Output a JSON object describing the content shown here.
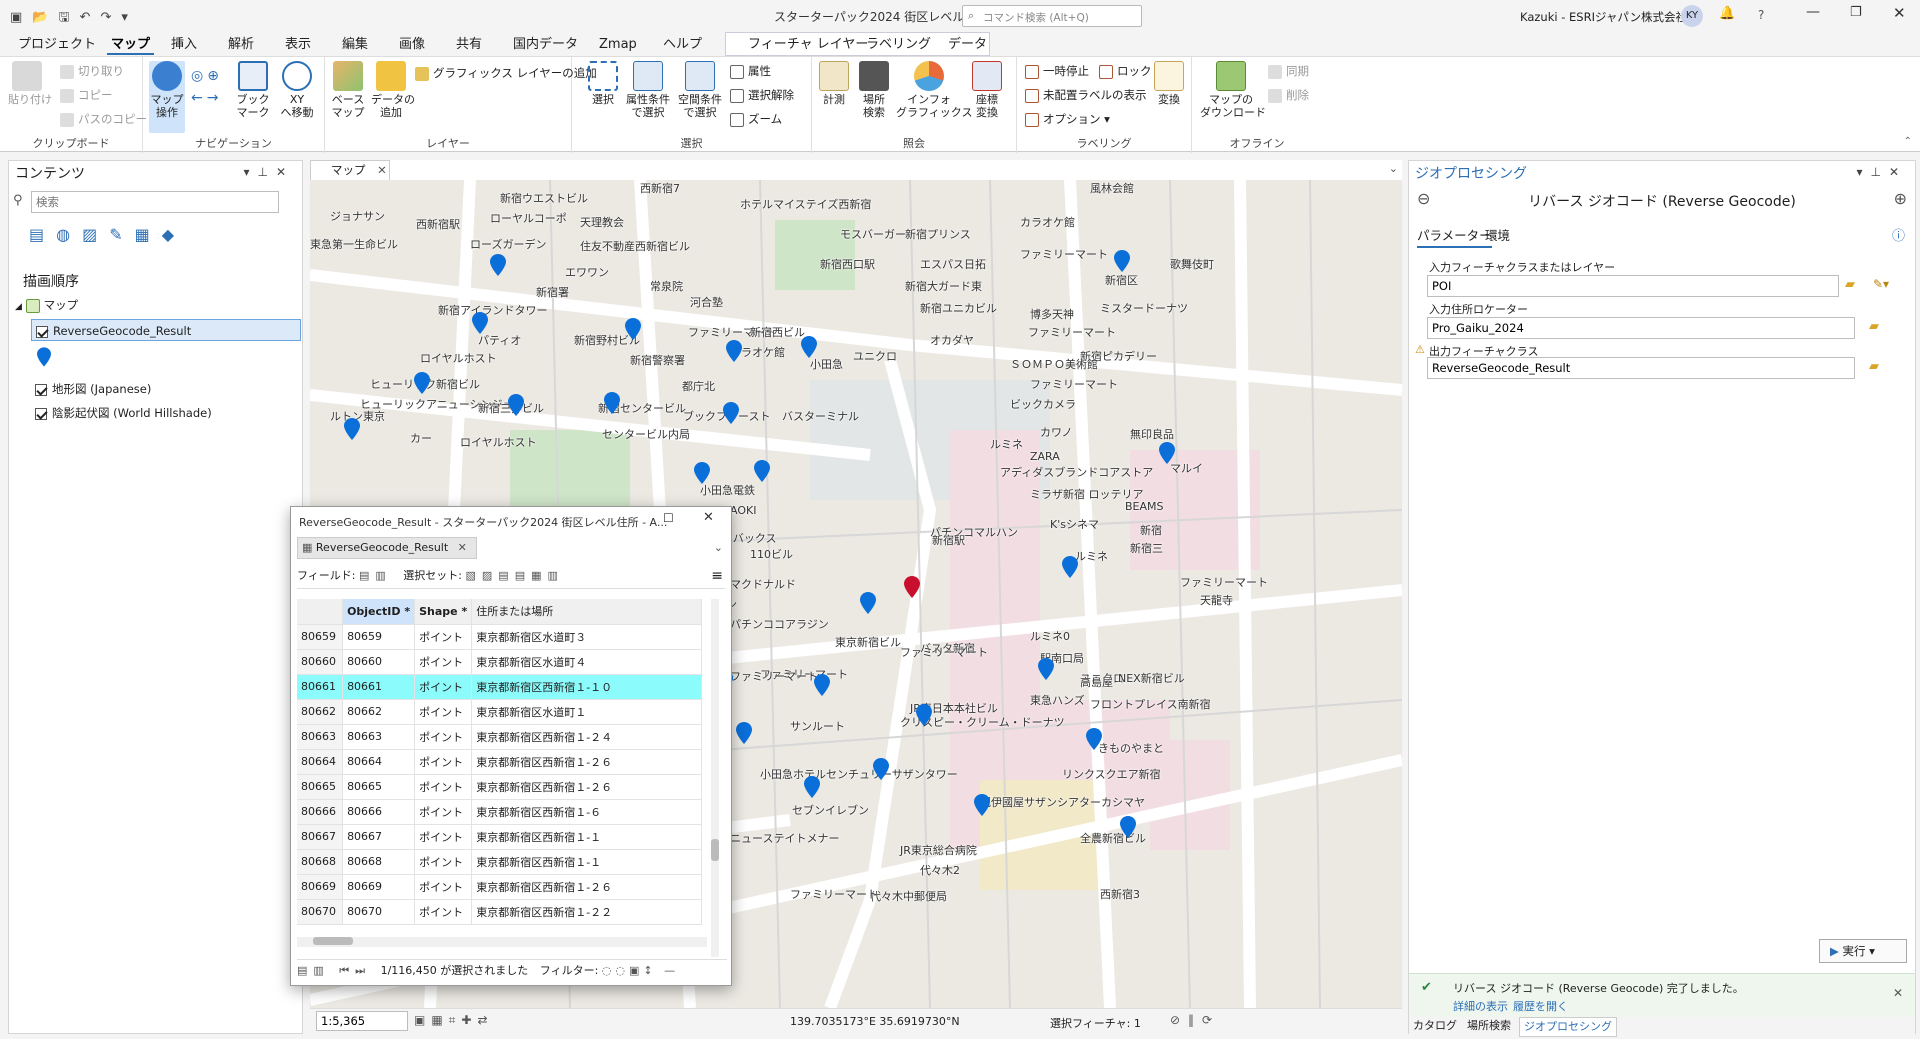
{
  "window": {
    "title": "スターターパック2024 街区レベル住所",
    "search_placeholder": "コマンド検索 (Alt+Q)",
    "user": "Kazuki - ESRIジャパン株式会社",
    "user_initials": "KY"
  },
  "ribbon_tabs": [
    "プロジェクト",
    "マップ",
    "挿入",
    "解析",
    "表示",
    "編集",
    "画像",
    "共有",
    "国内データ",
    "Zmap",
    "ヘルプ",
    "フィーチャ レイヤー",
    "ラベリング",
    "データ"
  ],
  "ribbon": {
    "clipboard": {
      "paste": "貼り付け",
      "cut": "切り取り",
      "copy": "コピー",
      "copy_path": "パスのコピー",
      "group": "クリップボード"
    },
    "navigation": {
      "explore": "マップ\n操作",
      "bookmark": "ブック\nマーク",
      "xy": "XY\nへ移動",
      "group": "ナビゲーション"
    },
    "layer": {
      "basemap": "ベース\nマップ",
      "add_data": "データの\n追加",
      "add_graphics": "グラフィックス レイヤーの追加",
      "group": "レイヤー"
    },
    "selection": {
      "select": "選択",
      "by_attr": "属性条件\nで選択",
      "by_loc": "空間条件\nで選択",
      "attributes": "属性",
      "clear": "選択解除",
      "zoom": "ズーム",
      "group": "選択"
    },
    "inquiry": {
      "measure": "計測",
      "locate": "場所\n検索",
      "infographics": "インフォ\nグラフィックス",
      "coord": "座標\n変換",
      "group": "照会"
    },
    "labeling": {
      "pause": "一時停止",
      "lock": "ロック",
      "unplaced": "未配置ラベルの表示",
      "convert": "変換",
      "options": "オプション",
      "group": "ラベリング"
    },
    "offline": {
      "download": "マップの\nダウンロード",
      "sync": "同期",
      "remove": "削除",
      "group": "オフライン"
    }
  },
  "contents": {
    "title": "コンテンツ",
    "search_placeholder": "検索",
    "draw_order": "描画順序",
    "map_label": "マップ",
    "layers": [
      "ReverseGeocode_Result",
      "地形図 (Japanese)",
      "陰影起伏図 (World Hillshade)"
    ]
  },
  "map_tab": "マップ",
  "map_labels": [
    "西新宿7",
    "新宿ウエストビル",
    "ホテルマイステイズ西新宿",
    "ジョナサン",
    "ローヤルコーポ",
    "天理教会",
    "風林会館",
    "西新宿駅",
    "住友不動産西新宿ビル",
    "新宿プリンス",
    "カラオケ館",
    "ローズガーデン",
    "モスバーガー",
    "エスパス日拓",
    "ファミリーマート",
    "新宿区",
    "エワワン",
    "常泉院",
    "新宿西口駅",
    "新宿大ガード東",
    "歌舞伎町",
    "新宿署",
    "河合塾",
    "新宿ユニカビル",
    "ミスタードーナツ",
    "新宿アイランドタワー",
    "博多天神",
    "パティオ",
    "新宿野村ビル",
    "ファミリーマート",
    "新宿西ビル",
    "ファミリーマート",
    "ロイヤルホスト",
    "カラオケ館",
    "小田急",
    "ユニクロ",
    "オカダヤ",
    "新宿ピカデリー",
    "新宿警察署",
    "ＳＯＭＰＯ美術館",
    "ヒューリック新宿ビル",
    "都庁北",
    "ファミリーマート",
    "ヒューリックアニューシンジュク",
    "新宿三井ビル",
    "新宿センタービル",
    "ブックファースト",
    "バスターミナル",
    "ビックカメラ",
    "センタービル内局",
    "カワノ",
    "無印良品",
    "ロイヤルホスト",
    "ルミネ",
    "ZARA",
    "マルイ",
    "アディダスブランドコアストア",
    "小田急電鉄",
    "ミラザ新宿 ロッテリア",
    "AOKI",
    "BEAMS",
    "新宿",
    "パチンコマルハン",
    "K'sシネマ",
    "スターバックス",
    "110ビル",
    "新宿駅",
    "新宿三",
    "マクドナルド",
    "ルミネ",
    "ファミリーマート",
    "セブンイレブン",
    "天龍寺",
    "パチンココアラジン",
    "東京新宿ビル",
    "バスタ新宿",
    "ルミネ0",
    "ファミリーマート",
    "ファミリーマート",
    "駅南口局",
    "ファミリーマート",
    "ユニクロ",
    "NEX新宿ビル",
    "JR東日本本社ビル",
    "東急ハンズ",
    "高島屋",
    "フロントプレイス南新宿",
    "サンルート",
    "クリスピー・クリーム・ドーナツ",
    "全労済",
    "きものやまと",
    "小田急ホテルセンチュリーサザンタワー",
    "リンクスクエア新宿",
    "セブンイレブン",
    "紀伊國屋サザンシアターカシマヤ",
    "ニューステイトメナー",
    "JR東京総合病院",
    "全農新宿ビル",
    "代々木2",
    "代々木中郵便局",
    "ファミリーマート",
    "西新宿3",
    "ルトン東京",
    "ミルーコート",
    "東急第一生命ビル",
    "カー",
    "ーマート"
  ],
  "table": {
    "window_title": "ReverseGeocode_Result - スターターパック2024 街区レベル住所 - A...",
    "tab": "ReverseGeocode_Result",
    "field_label": "フィールド:",
    "selset_label": "選択セット:",
    "columns": [
      "ObjectID *",
      "Shape *",
      "住所または場所"
    ],
    "rows": [
      {
        "idx": "80659",
        "oid": "80659",
        "shape": "ポイント",
        "addr": "東京都新宿区水道町３",
        "sel": false
      },
      {
        "idx": "80660",
        "oid": "80660",
        "shape": "ポイント",
        "addr": "東京都新宿区水道町４",
        "sel": false
      },
      {
        "idx": "80661",
        "oid": "80661",
        "shape": "ポイント",
        "addr": "東京都新宿区西新宿１-１０",
        "sel": true
      },
      {
        "idx": "80662",
        "oid": "80662",
        "shape": "ポイント",
        "addr": "東京都新宿区水道町１",
        "sel": false
      },
      {
        "idx": "80663",
        "oid": "80663",
        "shape": "ポイント",
        "addr": "東京都新宿区西新宿１-２４",
        "sel": false
      },
      {
        "idx": "80664",
        "oid": "80664",
        "shape": "ポイント",
        "addr": "東京都新宿区西新宿１-２６",
        "sel": false
      },
      {
        "idx": "80665",
        "oid": "80665",
        "shape": "ポイント",
        "addr": "東京都新宿区西新宿１-２６",
        "sel": false
      },
      {
        "idx": "80666",
        "oid": "80666",
        "shape": "ポイント",
        "addr": "東京都新宿区西新宿１-６",
        "sel": false
      },
      {
        "idx": "80667",
        "oid": "80667",
        "shape": "ポイント",
        "addr": "東京都新宿区西新宿１-１",
        "sel": false
      },
      {
        "idx": "80668",
        "oid": "80668",
        "shape": "ポイント",
        "addr": "東京都新宿区西新宿１-１",
        "sel": false
      },
      {
        "idx": "80669",
        "oid": "80669",
        "shape": "ポイント",
        "addr": "東京都新宿区西新宿１-２６",
        "sel": false
      },
      {
        "idx": "80670",
        "oid": "80670",
        "shape": "ポイント",
        "addr": "東京都新宿区西新宿１-２２",
        "sel": false
      }
    ],
    "status": "1/116,450 が選択されました",
    "filter_label": "フィルター:"
  },
  "map_status": {
    "scale": "1:5,365",
    "coords": "139.7035173°E 35.6919730°N",
    "selected": "選択フィーチャ: 1"
  },
  "geoprocessing": {
    "title": "ジオプロセシング",
    "tool": "リバース ジオコード (Reverse Geocode)",
    "tabs": [
      "パラメーター",
      "環境"
    ],
    "p1_label": "入力フィーチャクラスまたはレイヤー",
    "p1_value": "POI",
    "p2_label": "入力住所ロケーター",
    "p2_value": "Pro_Gaiku_2024",
    "p3_label": "出力フィーチャクラス",
    "p3_value": "ReverseGeocode_Result",
    "run": "実行",
    "done_msg": "リバース ジオコード (Reverse Geocode) 完了しました。",
    "details": "詳細の表示",
    "history": "履歴を開く",
    "bottom_tabs": [
      "カタログ",
      "場所検索",
      "ジオプロセシング"
    ]
  },
  "colors": {
    "accent": "#2d6fb5",
    "pin": "#0a6fd9",
    "selected_pin": "#c8102e",
    "selected_row": "#8cfbfb",
    "success": "#2e8540"
  }
}
